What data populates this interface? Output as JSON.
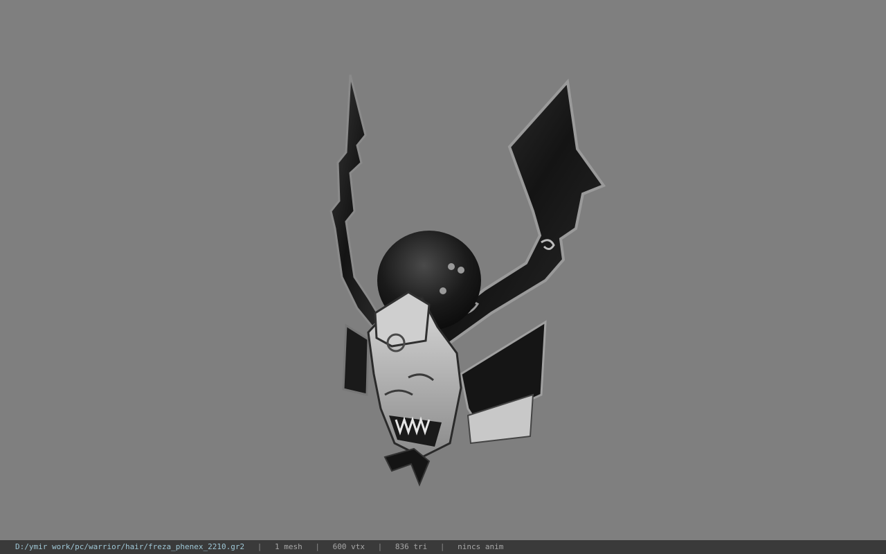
{
  "viewer": {
    "background": "#7f7f7f",
    "model_icon": "samurai-helmet-model"
  },
  "statusbar": {
    "file_path": "D:/ymir work/pc/warrior/hair/freza_phenex_2210.gr2",
    "separator": "|",
    "mesh_count": "1 mesh",
    "vertex_count": "600 vtx",
    "triangle_count": "836 tri",
    "anim_status": "nincs anim"
  }
}
